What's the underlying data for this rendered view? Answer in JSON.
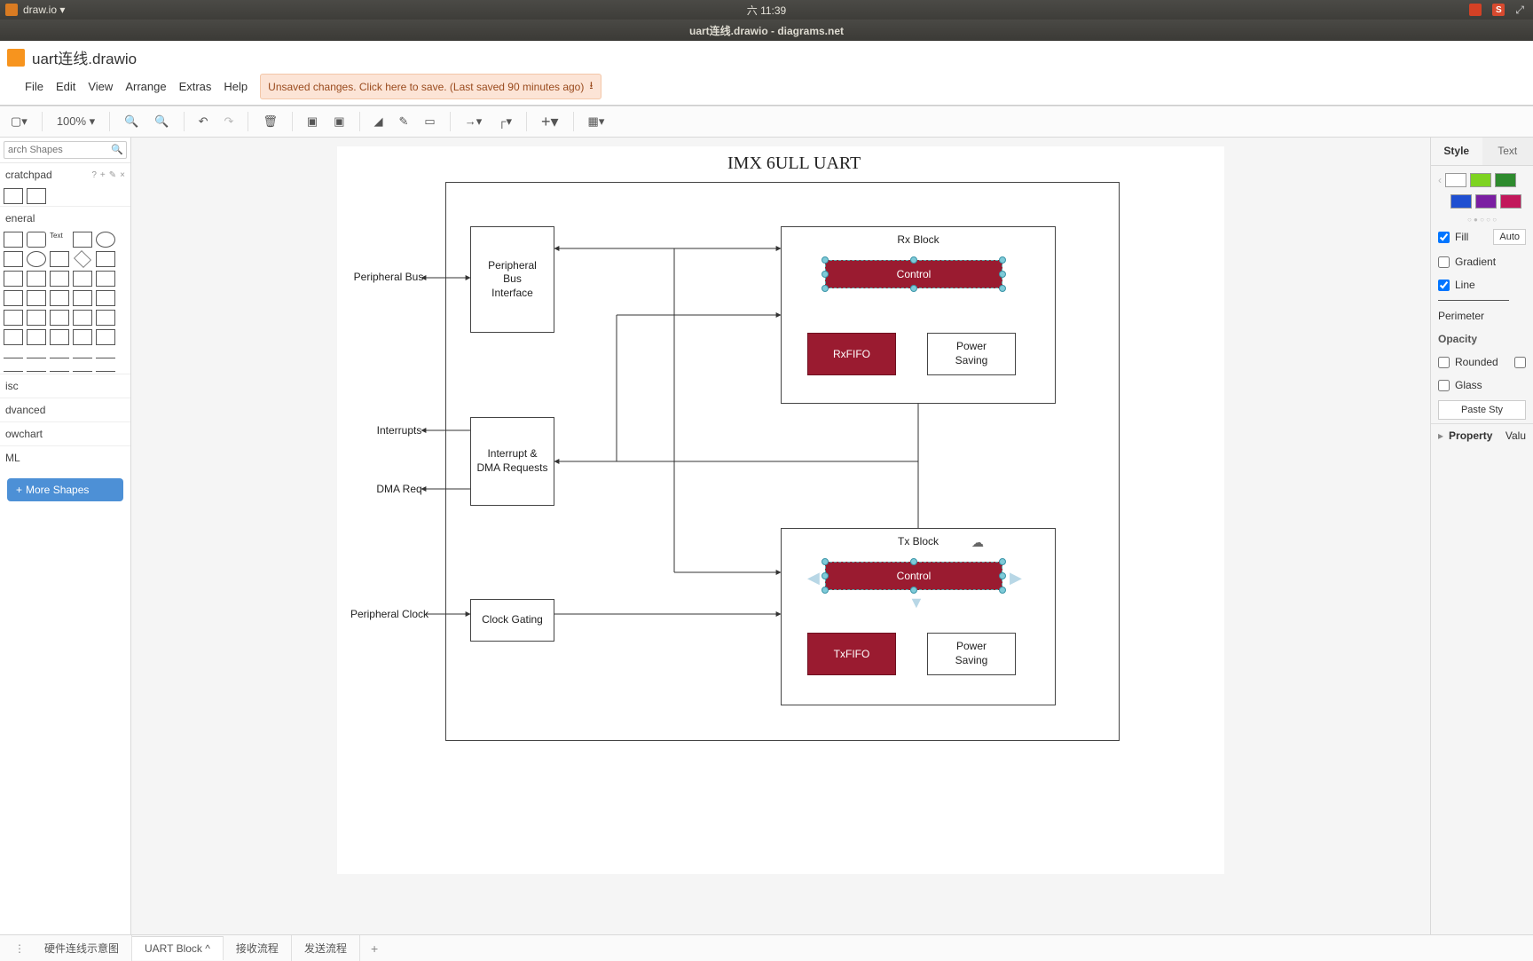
{
  "topbar": {
    "appname": "draw.io ▾",
    "clock": "六 11:39"
  },
  "titlebar": "uart连线.drawio - diagrams.net",
  "filename": "uart连线.drawio",
  "menu": {
    "file": "File",
    "edit": "Edit",
    "view": "View",
    "arrange": "Arrange",
    "extras": "Extras",
    "help": "Help"
  },
  "savemsg": "Unsaved changes. Click here to save. (Last saved 90 minutes ago)",
  "toolbar": {
    "zoom": "100% ▾"
  },
  "left": {
    "search_ph": "arch Shapes",
    "scratchpad": "cratchpad",
    "general": "eneral",
    "misc": "isc",
    "advanced": "dvanced",
    "flowchart": "owchart",
    "uml": "ML",
    "more": "More Shapes"
  },
  "diagram": {
    "title": "IMX 6ULL UART",
    "pbi": "Peripheral\nBus\nInterface",
    "idr": "Interrupt &\nDMA Requests",
    "cg": "Clock Gating",
    "rx_title": "Rx Block",
    "tx_title": "Tx Block",
    "control": "Control",
    "rxfifo": "RxFIFO",
    "txfifo": "TxFIFO",
    "ps": "Power\nSaving",
    "lbl_pbus": "Peripheral Bus",
    "lbl_int": "Interrupts",
    "lbl_dma": "DMA Req",
    "lbl_pclk": "Peripheral Clock"
  },
  "right": {
    "tab_style": "Style",
    "tab_text": "Text",
    "fill": "Fill",
    "auto": "Auto",
    "gradient": "Gradient",
    "line": "Line",
    "perimeter": "Perimeter",
    "opacity": "Opacity",
    "rounded": "Rounded",
    "glass": "Glass",
    "paste": "Paste Sty",
    "property": "Property",
    "value": "Valu"
  },
  "tabs": {
    "t1": "硬件连线示意图",
    "t2": "UART Block",
    "t3": "接收流程",
    "t4": "发送流程"
  },
  "swatches": {
    "white": "#ffffff",
    "lime": "#7ed321",
    "green": "#2e8b2e",
    "blue": "#1f4fd1",
    "purple": "#7b1fa2",
    "magenta": "#c2185b"
  }
}
